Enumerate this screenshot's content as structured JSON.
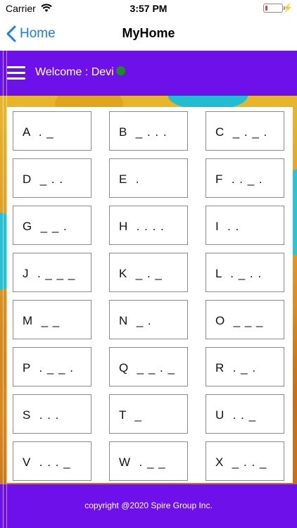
{
  "status_bar": {
    "carrier": "Carrier",
    "time": "3:57 PM",
    "battery_level": 0.15,
    "battery_color": "#e23b3b"
  },
  "nav": {
    "back_label": "Home",
    "title": "MyHome",
    "accent": "#1a7cf7"
  },
  "header": {
    "welcome": "Welcome : Devi",
    "background": "#6e10ea",
    "status_color": "#1f8a1f"
  },
  "morse": [
    {
      "text": "A ._"
    },
    {
      "text": "B _..."
    },
    {
      "text": "C _._."
    },
    {
      "text": "D _.."
    },
    {
      "text": "E ."
    },
    {
      "text": "F .._."
    },
    {
      "text": "G __."
    },
    {
      "text": "H ...."
    },
    {
      "text": "I .."
    },
    {
      "text": "J .___"
    },
    {
      "text": "K _._"
    },
    {
      "text": "L ._.."
    },
    {
      "text": "M __"
    },
    {
      "text": "N _."
    },
    {
      "text": "O ___"
    },
    {
      "text": "P .__."
    },
    {
      "text": "Q __._"
    },
    {
      "text": "R ._."
    },
    {
      "text": "S ..."
    },
    {
      "text": "T _"
    },
    {
      "text": "U .._"
    },
    {
      "text": "V ..._"
    },
    {
      "text": "W .__"
    },
    {
      "text": "X _.._"
    }
  ],
  "footer": {
    "text": "copyright @2020 Spire Group Inc."
  }
}
